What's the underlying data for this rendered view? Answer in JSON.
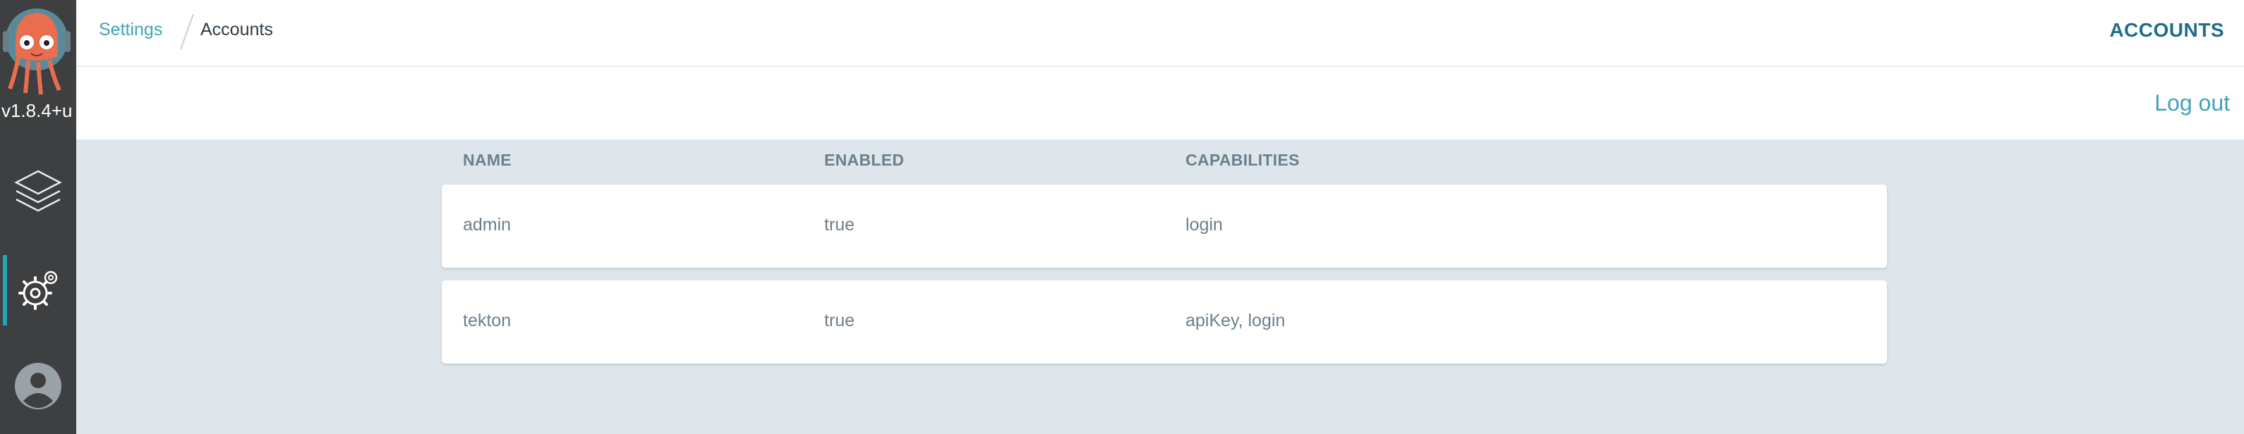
{
  "sidebar": {
    "version": "v1.8.4+u",
    "items": [
      {
        "name": "applications",
        "icon": "layers-icon"
      },
      {
        "name": "settings",
        "icon": "gear-icon",
        "active": true
      },
      {
        "name": "user-info",
        "icon": "user-avatar-icon"
      }
    ],
    "accent_color": "#1fa7b4"
  },
  "header": {
    "breadcrumb": [
      "Settings",
      "Accounts"
    ],
    "title": "ACCOUNTS"
  },
  "toolbar": {
    "logout_label": "Log out"
  },
  "table": {
    "columns": [
      "NAME",
      "ENABLED",
      "CAPABILITIES"
    ],
    "rows": [
      {
        "name": "admin",
        "enabled": "true",
        "capabilities": "login"
      },
      {
        "name": "tekton",
        "enabled": "true",
        "capabilities": "apiKey, login"
      }
    ]
  }
}
